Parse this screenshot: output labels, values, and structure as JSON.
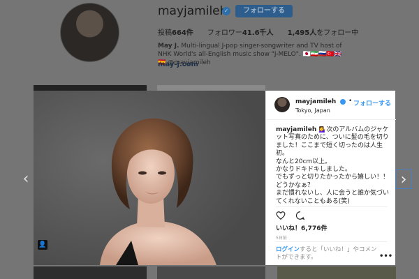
{
  "profile": {
    "username": "mayjamileh",
    "follow_label": "フォローする",
    "posts_label": "投稿",
    "posts_count": "664件",
    "followers_label": "フォロワー",
    "followers_count": "41.6千人",
    "following_count": "1,495人",
    "following_label": "をフォロー中",
    "bio_name": "May J.",
    "bio_text": " Multi-lingual J-pop singer-songwriter and TV host of NHK World's all-English music show \"J-MELO\". 🇯🇵🇮🇷🇷🇺🇹🇷🇬🇧🇪🇸 @mayjamileh",
    "link": "may-j.com"
  },
  "modal": {
    "user": "mayjamileh",
    "dot": "•",
    "follow_label": "フォローする",
    "location": "Tokyo, Japan",
    "caption_user": "mayjamileh",
    "caption_text": " 💁‍♀️次のアルバムのジャケット写真のために、ついに髪の毛を切りました！ここまで短く切ったのは人生初。\nなんと20cm以上。\nかなりドキドキしました。\nでもずっと切りたかったから嬉しい！！\nどうかなぁ？\nまだ慣れないし、人に会うと誰か気づいてくれないこともある(笑)\n今までロングじゃないと自分じゃないって決めつけていたけど、もうそんなこだわりも",
    "likes": "いいね！6,776件",
    "date": "5日前",
    "login_link": "ログイン",
    "login_text": "すると「いいね！」やコメントができます。",
    "more": "•••"
  },
  "nav": {
    "prev": "‹",
    "next": "›"
  },
  "icons": {
    "verified": "verified-badge-icon",
    "like": "heart-icon",
    "comment": "comment-icon",
    "tag": "user-tag-icon",
    "more": "more-options-icon"
  },
  "colors": {
    "accent": "#3897f0",
    "overlay": "#757575"
  }
}
